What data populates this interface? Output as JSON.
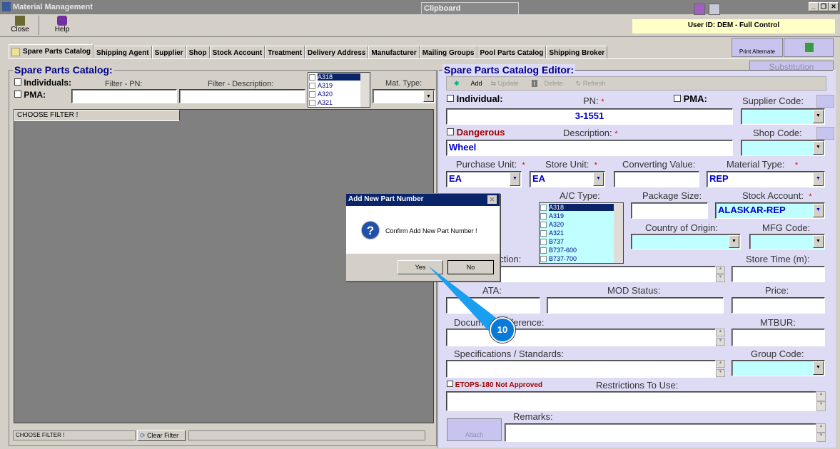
{
  "window": {
    "title": "Material Management",
    "clipboard": "Clipboard",
    "user": "User ID: DEM - Full Control"
  },
  "toolbar": {
    "close": "Close",
    "help": "Help"
  },
  "tabs": [
    "Spare Parts Catalog",
    "Shipping Agent",
    "Supplier",
    "Shop",
    "Stock Account",
    "Treatment",
    "Delivery Address",
    "Manufacturer",
    "Mailing Groups",
    "Pool Parts Catalog",
    "Shipping Broker"
  ],
  "right_buttons": {
    "print_alternate": "Print Alternate",
    "substitution": "Substitution"
  },
  "catalog": {
    "title": "Spare Parts Catalog:",
    "individuals": "Individuals:",
    "pma": "PMA:",
    "filter_pn": "Filter - PN:",
    "filter_desc": "Filter - Description:",
    "mat_type": "Mat. Type:",
    "ac_list": [
      "A318",
      "A319",
      "A320",
      "A321"
    ],
    "grid_header": "CHOOSE FILTER !",
    "status": "CHOOSE FILTER !",
    "clear_filter": "Clear Filter"
  },
  "editor": {
    "title": "Spare Parts Catalog Editor:",
    "add": "Add",
    "update": "Update",
    "delete": "Delete",
    "refresh": "Refresh",
    "individual": "Individual:",
    "pn_label": "PN:",
    "pn": "3-1551",
    "pma": "PMA:",
    "supplier_code": "Supplier Code:",
    "dangerous": "Dangerous",
    "desc_label": "Description:",
    "desc": "Wheel",
    "shop_code": "Shop Code:",
    "purchase_unit": "Purchase Unit:",
    "purchase_unit_val": "EA",
    "store_unit": "Store Unit:",
    "store_unit_val": "EA",
    "converting": "Converting Value:",
    "material_type": "Material Type:",
    "material_type_val": "REP",
    "ac_type": "A/C Type:",
    "ac_types": [
      "A318",
      "A319",
      "A320",
      "A321",
      "B737",
      "B737-600",
      "B737-700"
    ],
    "package_size": "Package Size:",
    "stock_account": "Stock Account:",
    "stock_account_val": "ALASKAR-REP",
    "country": "Country of Origin:",
    "mfg": "MFG Code:",
    "instruction": "uction:",
    "store_time": "Store Time (m):",
    "ata": "ATA:",
    "mod": "MOD Status:",
    "price": "Price:",
    "doc_ref": "Document Reference:",
    "mtbur": "MTBUR:",
    "specs": "Specifications / Standards:",
    "group_code": "Group Code:",
    "etops": "ETOPS-180 Not Approved",
    "restrictions": "Restrictions To Use:",
    "remarks": "Remarks:",
    "attach": "Attach",
    "required": "*"
  },
  "dialog": {
    "title": "Add New Part Number",
    "message": "Confirm Add New Part Number !",
    "yes": "Yes",
    "no": "No"
  },
  "callout": {
    "step": "10"
  }
}
